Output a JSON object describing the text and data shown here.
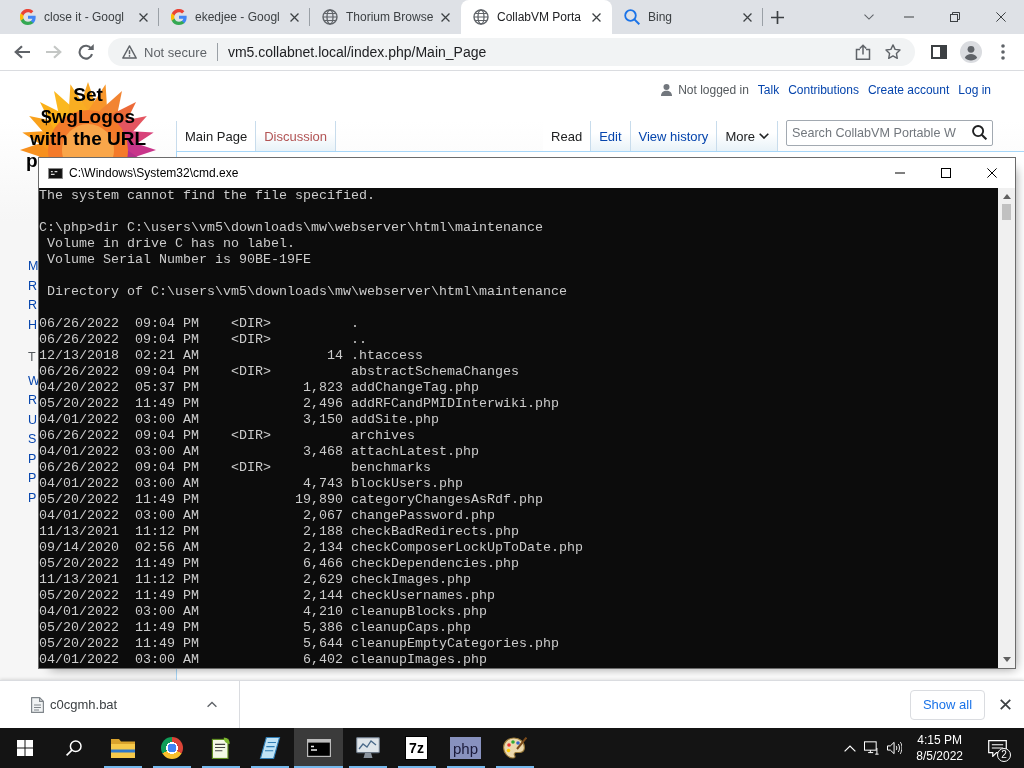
{
  "browser": {
    "tabs": [
      {
        "title": "close it - Googl",
        "kind": "g",
        "selected": false
      },
      {
        "title": "ekedjee - Googl",
        "kind": "g",
        "selected": false
      },
      {
        "title": "Thorium Browse",
        "kind": "globe",
        "selected": false
      },
      {
        "title": "CollabVM Porta",
        "kind": "globe",
        "selected": true
      },
      {
        "title": "Bing",
        "kind": "search",
        "selected": false
      }
    ],
    "nav_buttons": [
      {
        "kind": "back",
        "disabled": false
      },
      {
        "kind": "forward",
        "disabled": true
      },
      {
        "kind": "reload",
        "disabled": false
      }
    ],
    "address_bar": {
      "security": "Not secure",
      "url": "vm5.collabnet.local/index.php/Main_Page"
    }
  },
  "wiki": {
    "logo_lines": [
      "Set",
      "$wgLogos",
      "with the URL",
      "p"
    ],
    "personal_tools": {
      "status": "Not logged in",
      "links": [
        "Talk",
        "Contributions",
        "Create account",
        "Log in"
      ]
    },
    "namespace_tabs": [
      {
        "label": "Main Page",
        "selected": true,
        "missing": false
      },
      {
        "label": "Discussion",
        "selected": false,
        "missing": true
      }
    ],
    "view_tabs": [
      {
        "label": "Read",
        "selected": true
      },
      {
        "label": "Edit",
        "selected": false
      },
      {
        "label": "View history",
        "selected": false
      }
    ],
    "more_menu": {
      "label": "More"
    },
    "search": {
      "placeholder": "Search CollabVM Portable W"
    },
    "sidebar": [
      {
        "items": [
          "M",
          "R",
          "R",
          "H"
        ]
      },
      {
        "heading": "T",
        "items": [
          "W",
          "R",
          "U",
          "S",
          "P",
          "P",
          "P"
        ]
      }
    ]
  },
  "console_window": {
    "title": "C:\\Windows\\System32\\cmd.exe",
    "output_blocks": [
      [
        "The system cannot find the file specified."
      ],
      [
        "C:\\php>dir C:\\users\\vm5\\downloads\\mw\\webserver\\html\\maintenance",
        " Volume in drive C has no label.",
        " Volume Serial Number is 90BE-19FE"
      ],
      [
        " Directory of C:\\users\\vm5\\downloads\\mw\\webserver\\html\\maintenance"
      ],
      [
        "06/26/2022  09:04 PM    <DIR>          .",
        "06/26/2022  09:04 PM    <DIR>          ..",
        "12/13/2018  02:21 AM                14 .htaccess",
        "06/26/2022  09:04 PM    <DIR>          abstractSchemaChanges",
        "04/20/2022  05:37 PM             1,823 addChangeTag.php",
        "05/20/2022  11:49 PM             2,496 addRFCandPMIDInterwiki.php",
        "04/01/2022  03:00 AM             3,150 addSite.php",
        "06/26/2022  09:04 PM    <DIR>          archives",
        "04/01/2022  03:00 AM             3,468 attachLatest.php",
        "06/26/2022  09:04 PM    <DIR>          benchmarks",
        "04/01/2022  03:00 AM             4,743 blockUsers.php",
        "05/20/2022  11:49 PM            19,890 categoryChangesAsRdf.php",
        "04/01/2022  03:00 AM             2,067 changePassword.php",
        "11/13/2021  11:12 PM             2,188 checkBadRedirects.php",
        "09/14/2020  02:56 AM             2,134 checkComposerLockUpToDate.php",
        "05/20/2022  11:49 PM             6,466 checkDependencies.php",
        "11/13/2021  11:12 PM             2,629 checkImages.php",
        "05/20/2022  11:49 PM             2,144 checkUsernames.php",
        "04/01/2022  03:00 AM             4,210 cleanupBlocks.php",
        "05/20/2022  11:49 PM             5,386 cleanupCaps.php",
        "05/20/2022  11:49 PM             5,644 cleanupEmptyCategories.php",
        "04/01/2022  03:00 AM             6,402 cleanupImages.php"
      ]
    ]
  },
  "download_bar": {
    "file_name": "c0cgmh.bat",
    "show_all": "Show all"
  },
  "taskbar": {
    "apps": [
      {
        "kind": "start"
      },
      {
        "kind": "search"
      },
      {
        "kind": "folder",
        "running": true,
        "active": false
      },
      {
        "kind": "circle",
        "running": true,
        "active": false
      },
      {
        "kind": "notepad",
        "running": true,
        "active": false
      },
      {
        "kind": "notebook",
        "running": true,
        "active": false
      },
      {
        "kind": "console",
        "running": true,
        "active": true
      },
      {
        "kind": "monitor",
        "running": true,
        "active": false
      },
      {
        "kind": "tile",
        "label": "7z",
        "running": true,
        "active": false
      },
      {
        "kind": "tile-purple",
        "label": "php",
        "running": true,
        "active": false
      },
      {
        "kind": "palette",
        "running": true,
        "active": false
      }
    ],
    "clock": {
      "time": "4:15 PM",
      "date": "8/5/2022"
    },
    "notification_count": "2"
  }
}
